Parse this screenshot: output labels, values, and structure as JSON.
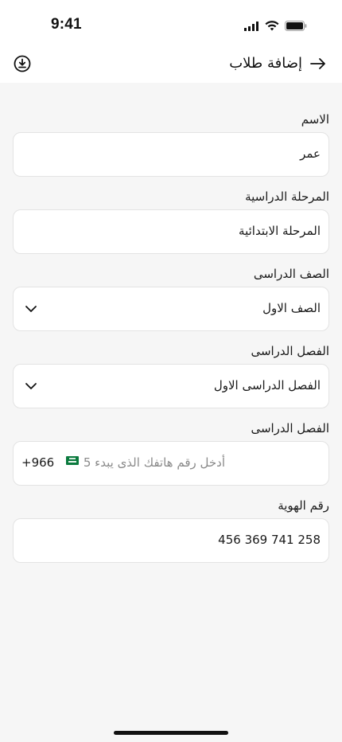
{
  "status_bar": {
    "time": "9:41",
    "icons": [
      "cellular-signal-icon",
      "wifi-icon",
      "battery-icon"
    ]
  },
  "header": {
    "title": "إضافة طلاب",
    "back_icon": "arrow-right-icon",
    "action_icon": "download-icon"
  },
  "form": {
    "fields": [
      {
        "label": "الاسم",
        "value": "عمر"
      },
      {
        "label": "المرحلة الدراسية",
        "value": "المرحلة الابتدائية"
      },
      {
        "label": "الصف الدراسى",
        "value": "الصف الاول"
      },
      {
        "label": "الفصل الدراسى",
        "value": "الفصل الدراسى الاول"
      },
      {
        "label": "الفصل الدراسى",
        "placeholder": "أدخل رقم هاتفك الذى يبدء 5",
        "country_code": "+966"
      },
      {
        "label": "رقم الهوية",
        "value": "456 369 741 258"
      }
    ]
  },
  "colors": {
    "background": "#f6f6f6",
    "surface": "#ffffff",
    "border": "#e3e3e3",
    "text": "#1a1a1a",
    "placeholder": "#8a8a8a"
  }
}
